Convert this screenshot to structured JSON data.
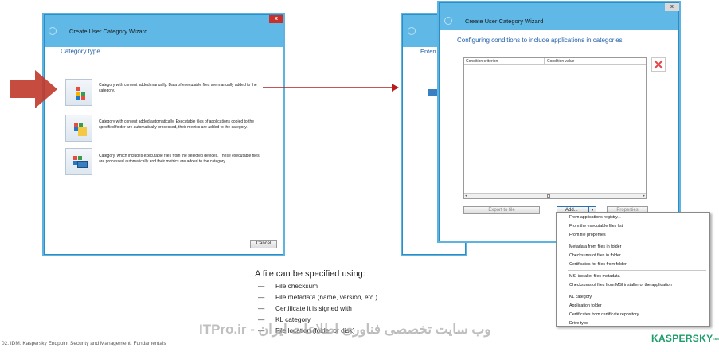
{
  "wizard1": {
    "title": "Create User Category Wizard",
    "heading": "Category type",
    "options": [
      {
        "text": "Category with content added manually. Data of executable files are manually added to the category."
      },
      {
        "text": "Category with content added automatically. Executable files of applications copied to the specified folder are automatically processed, their metrics are added to the category."
      },
      {
        "text": "Category, which includes executable files from the selected devices. These executable files are processed automatically and their metrics are added to the category."
      }
    ],
    "cancel_label": "Cancel",
    "close_glyph": "x"
  },
  "wizard_back": {
    "heading_fragment": "Enteri"
  },
  "wizard2": {
    "title": "Create User Category Wizard",
    "heading": "Configuring conditions to include applications in categories",
    "columns": [
      "Condition criterion",
      "Condition value"
    ],
    "export_label": "Export to file",
    "add_label": "Add...",
    "properties_label": "Properties",
    "close_glyph": "x"
  },
  "add_menu": {
    "groups": [
      [
        "From applications registry...",
        "From the executable files list",
        "From file properties"
      ],
      [
        "Metadata from files in folder",
        "Checksums of files in folder",
        "Certificates for files from folder"
      ],
      [
        "MSI installer files metadata",
        "Checksums of files from MSI installer of the application"
      ],
      [
        "KL category",
        "Application folder",
        "Certificates from certificate repository",
        "Drive type"
      ]
    ]
  },
  "bullets": {
    "title": "A file can be specified using:",
    "dash": "—",
    "items": [
      "File checksum",
      "File metadata (name, version, etc.)",
      "Certificate it is signed with",
      "KL category",
      "File location (folder or disk)"
    ]
  },
  "footer": {
    "left_text": "02. IDM: Kaspersky Endpoint Security and Management. Fundamentals",
    "watermark": "وب سایت تخصصی فناوری اطلاعات ایران - ITPro.ir",
    "brand": "KASPERSKY",
    "brand_suffix": "lab"
  },
  "colors": {
    "titlebar": "#5fb8e6",
    "heading": "#1f5fa8",
    "arrow_red": "#c0392b",
    "brand_green": "#1d9d6b"
  }
}
